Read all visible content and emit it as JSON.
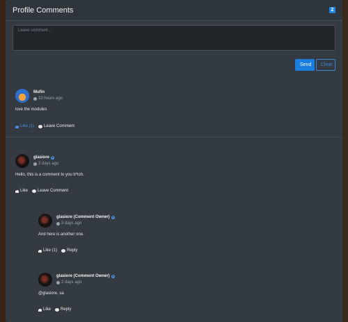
{
  "header": {
    "title": "Profile Comments",
    "count": "2"
  },
  "composer": {
    "placeholder": "Leave comment...",
    "send_label": "Send",
    "clear_label": "Clear"
  },
  "colors": {
    "accent": "#1a7de0",
    "panel": "#343a42",
    "header": "#2f353c"
  },
  "comments": [
    {
      "author": "Mufin",
      "time": "10 hours ago",
      "text": "love the modules",
      "like_label": "Like (1)",
      "reply_label": "Leave Comment"
    },
    {
      "author": "glasiore",
      "time": "3 days ago",
      "text": "Hello, this is a comment to you b*tch.",
      "like_label": "Like",
      "reply_label": "Leave Comment",
      "replies": [
        {
          "author": "glasiore (Comment Owner)",
          "time": "3 days ago",
          "text": "And here is another one.",
          "like_label": "Like (1)",
          "reply_label": "Reply"
        },
        {
          "author": "glasiore (Comment Owner)",
          "time": "2 days ago",
          "text": "@glasiore, sa",
          "like_label": "Like",
          "reply_label": "Reply"
        }
      ]
    }
  ]
}
